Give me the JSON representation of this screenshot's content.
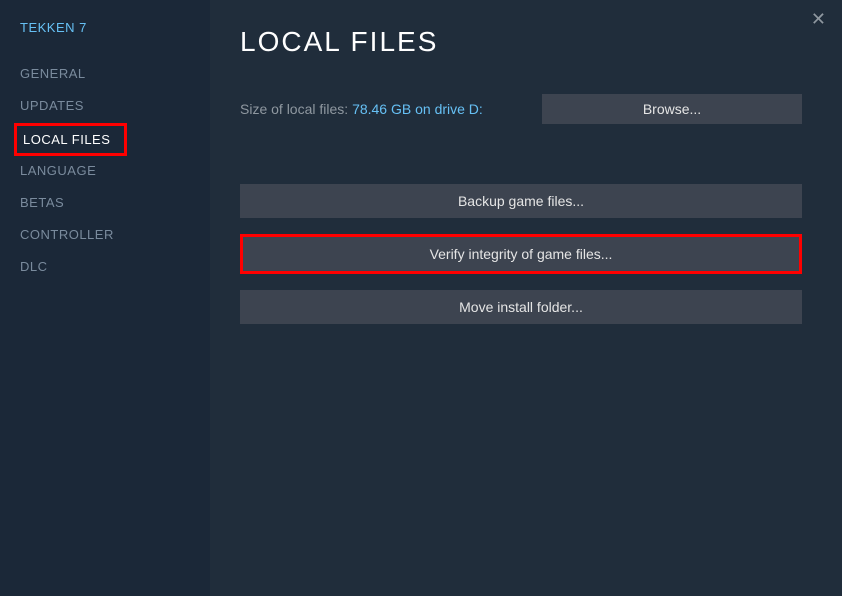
{
  "game_title": "TEKKEN 7",
  "sidebar": {
    "items": [
      {
        "label": "GENERAL",
        "name": "sidebar-item-general"
      },
      {
        "label": "UPDATES",
        "name": "sidebar-item-updates"
      },
      {
        "label": "LOCAL FILES",
        "name": "sidebar-item-local-files"
      },
      {
        "label": "LANGUAGE",
        "name": "sidebar-item-language"
      },
      {
        "label": "BETAS",
        "name": "sidebar-item-betas"
      },
      {
        "label": "CONTROLLER",
        "name": "sidebar-item-controller"
      },
      {
        "label": "DLC",
        "name": "sidebar-item-dlc"
      }
    ]
  },
  "main": {
    "title": "LOCAL FILES",
    "size_label": "Size of local files: ",
    "size_value": "78.46 GB on drive D:",
    "browse_label": "Browse...",
    "backup_label": "Backup game files...",
    "verify_label": "Verify integrity of game files...",
    "move_label": "Move install folder..."
  },
  "close_symbol": "✕"
}
